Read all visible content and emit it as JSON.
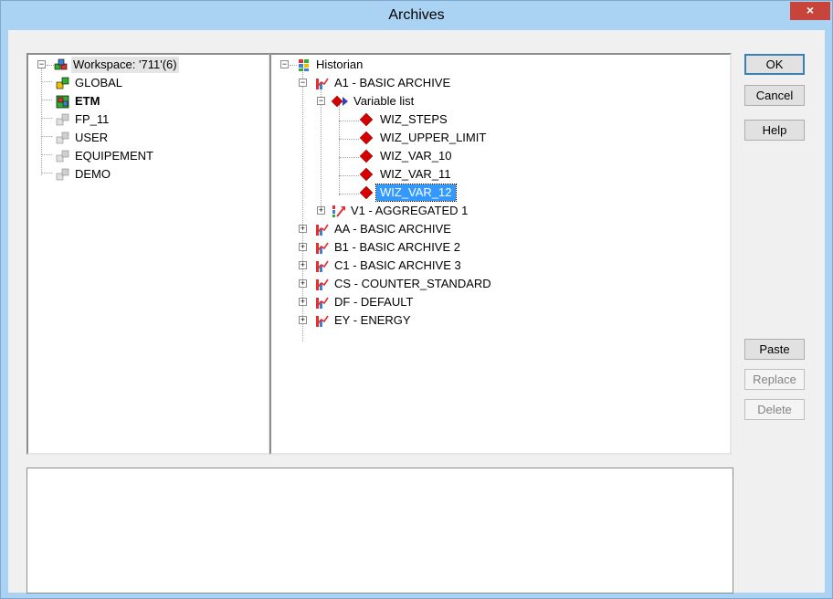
{
  "window": {
    "title": "Archives",
    "close_glyph": "×"
  },
  "workspace_tree": {
    "root": "Workspace: '711'(6)",
    "items": [
      "GLOBAL",
      "ETM",
      "FP_11",
      "USER",
      "EQUIPEMENT",
      "DEMO"
    ]
  },
  "historian_tree": {
    "root": "Historian",
    "a1": "A1 - BASIC ARCHIVE",
    "variable_list": "Variable list",
    "variables": [
      "WIZ_STEPS",
      "WIZ_UPPER_LIMIT",
      "WIZ_VAR_10",
      "WIZ_VAR_11",
      "WIZ_VAR_12"
    ],
    "v1": "V1 - AGGREGATED 1",
    "archives": [
      "AA - BASIC ARCHIVE",
      "B1 - BASIC ARCHIVE 2",
      "C1 - BASIC ARCHIVE 3",
      "CS - COUNTER_STANDARD",
      "DF - DEFAULT",
      "EY - ENERGY"
    ]
  },
  "buttons": {
    "ok": "OK",
    "cancel": "Cancel",
    "help": "Help",
    "paste": "Paste",
    "replace": "Replace",
    "delete": "Delete"
  },
  "colors": {
    "title_bg": "#a9d2f3",
    "selection": "#3399ff",
    "diamond_red": "#d40000"
  }
}
